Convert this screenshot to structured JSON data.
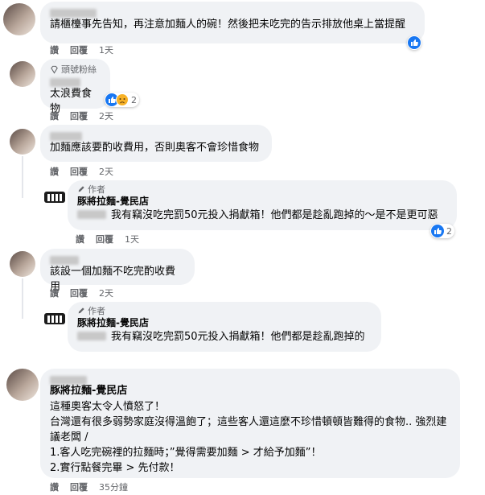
{
  "actions": {
    "like": "讚",
    "reply": "回覆"
  },
  "comments": [
    {
      "text": "請櫃檯事先告知，再注意加麵人的碗！然後把未吃完的告示排放他桌上當提醒",
      "time": "1天",
      "reactions": {
        "icons": [
          "like-icon"
        ],
        "count": ""
      }
    },
    {
      "badge": "頭號粉絲",
      "text": "太浪費食物",
      "time": "2天",
      "reactions": {
        "icons": [
          "like-icon",
          "sad-icon"
        ],
        "count": "2"
      }
    },
    {
      "text": "加麵應該要酌收費用，否則奧客不會珍惜食物",
      "time": "2天"
    },
    {
      "author_badge": "作者",
      "author": "豚將拉麵-覺民店",
      "text": "我有竊沒吃完罰50元投入捐獻箱！他們都是趁亂跑掉的～是不是更可惡",
      "time": "1天",
      "reactions": {
        "icons": [
          "like-icon"
        ],
        "count": "2"
      }
    },
    {
      "text": "該設一個加麵不吃完酌收費用",
      "time": "2天"
    },
    {
      "author_badge": "作者",
      "author": "豚將拉麵-覺民店",
      "text": "我有竊沒吃完罰50元投入捐獻箱！他們都是趁亂跑掉的",
      "time": ""
    },
    {
      "mention": "豚將拉麵-覺民店",
      "lines": [
        "這種奧客太令人憤怒了！",
        "台灣還有很多弱勢家庭沒得溫飽了；這些客人還這麼不珍惜頓頓皆難得的食物.. 強烈建議老闆 /",
        "1.客人吃完碗裡的拉麵時；”覺得需要加麵 > 才給予加麵”！",
        "2.實行點餐完畢 > 先付款！"
      ],
      "time": "35分鐘"
    }
  ],
  "colors": {
    "bubble": "#f0f2f5",
    "like_blue": "#1877f2",
    "meta_gray": "#65676b"
  }
}
